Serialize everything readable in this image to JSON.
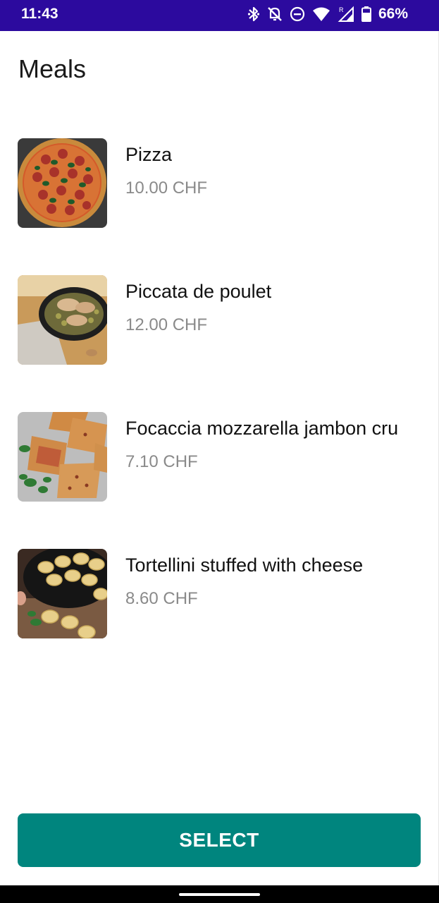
{
  "status_bar": {
    "time": "11:43",
    "battery_percent": "66%",
    "icons": [
      "bluetooth-icon",
      "bell-off-icon",
      "do-not-disturb-icon",
      "wifi-icon",
      "cell-signal-icon",
      "battery-icon"
    ]
  },
  "page": {
    "title": "Meals"
  },
  "meals": [
    {
      "name": "Pizza",
      "price": "10.00 CHF",
      "image": "pizza-photo"
    },
    {
      "name": "Piccata de poulet",
      "price": "12.00 CHF",
      "image": "chicken-piccata-photo"
    },
    {
      "name": "Focaccia mozzarella jambon cru",
      "price": "7.10 CHF",
      "image": "focaccia-photo"
    },
    {
      "name": "Tortellini stuffed with cheese",
      "price": "8.60 CHF",
      "image": "tortellini-photo"
    }
  ],
  "actions": {
    "select_label": "SELECT"
  },
  "colors": {
    "status_bar": "#2c0a9e",
    "accent": "#00857e",
    "price_text": "#8a8a8a"
  }
}
